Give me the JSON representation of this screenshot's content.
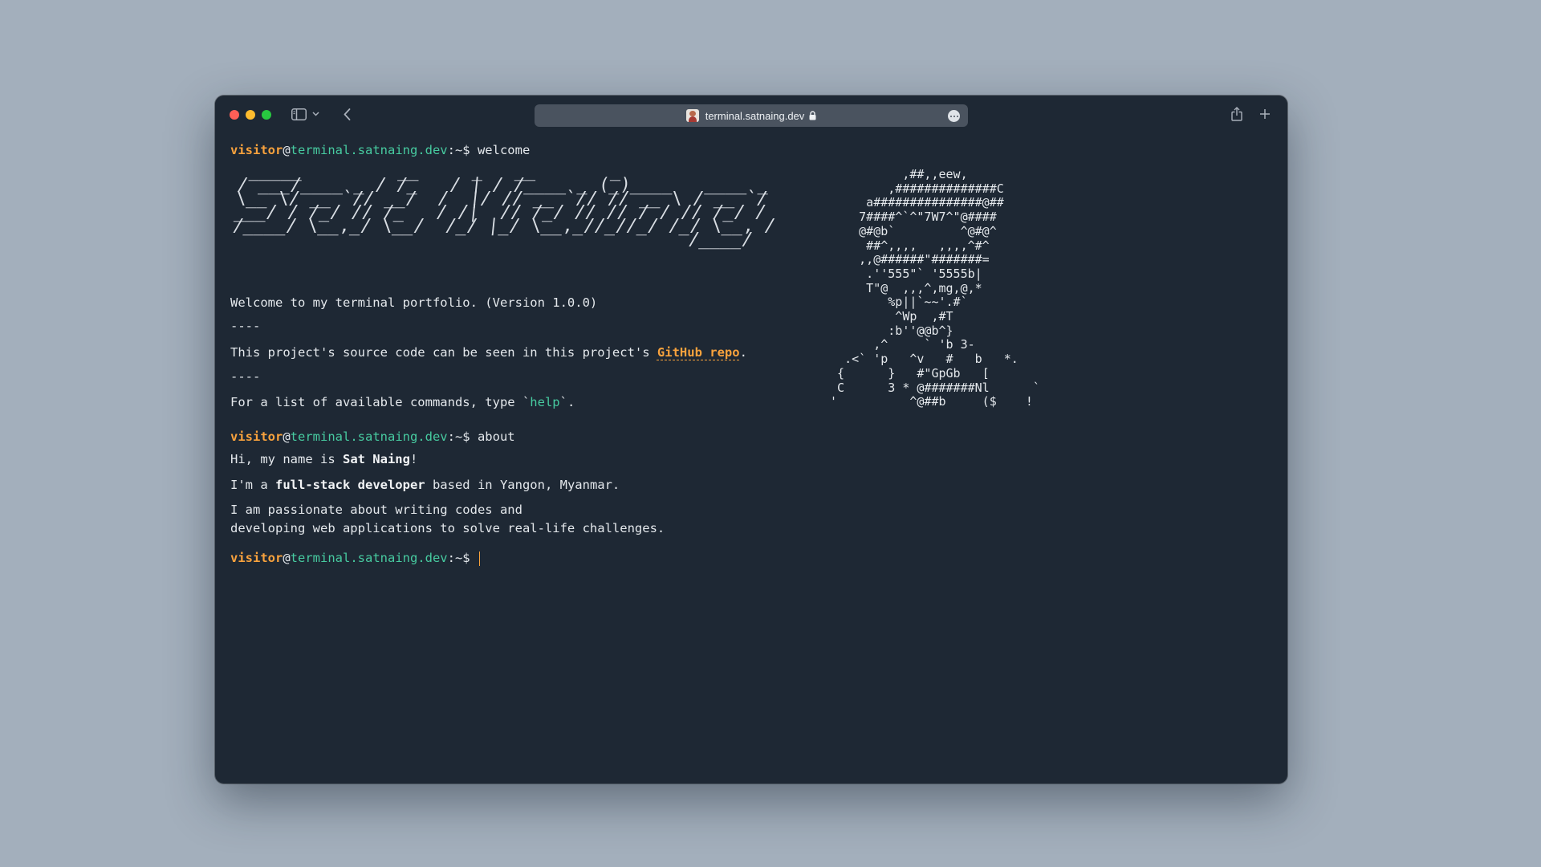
{
  "browser": {
    "url": "terminal.satnaing.dev"
  },
  "prompt": {
    "user": "visitor",
    "at": "@",
    "host": "terminal.satnaing.dev",
    "suffix": ":~$ "
  },
  "commands": {
    "first": "welcome",
    "second": "about"
  },
  "welcome": {
    "banner": " _____         __     _   __       _\n/ ___/____ _ / /_   / | / /____ _ (_)____   ____ _\n\\__ \\/ __ `// __/  /  |/ // __ `// // __ \\ / __ `/\n___/ / /_/ // /_   / /|  // /_/ // // / / // /_/ /\n/____/ \\__,_/ \\__/  /_/ |_/ \\__,_//_//_/ /_/ \\__, /\n                                           /____/",
    "intro": "Welcome to my terminal portfolio. (Version 1.0.0)",
    "separator": "----",
    "source_prefix": "This project's source code can be seen in this project's ",
    "source_link": "GitHub repo",
    "source_suffix": ".",
    "help_prefix": "For a list of available commands, type `",
    "help_cmd": "help",
    "help_suffix": "`.",
    "ascii_portrait": "           ,##,,eew,\n         ,##############C\n      a###############@##\n     7####^`^\"7W7^\"@####\n     @#@b`         ^@#@^\n      ##^,,,,   ,,,,^#^\n     ,,@######\"#######=\n      .''555\"` '5555b|\n      T\"@  ,,,^,mg,@,*\n         %p||`~~'.#`\n          ^Wp  ,#T\n         :b''@@b^}\n       ,^     ` 'b 3-\n   .<` 'p   ^v   #   b   *.\n  {      }   #\"GpGb   [\n  C      3 * @#######Nl      `\n '          ^@##b     ($    !"
  },
  "about": {
    "line1_prefix": "Hi, my name is ",
    "name": "Sat Naing",
    "line1_suffix": "!",
    "line2_prefix": "I'm a ",
    "role": "full-stack developer",
    "line2_suffix": " based in Yangon, Myanmar.",
    "line3": "I am passionate about writing codes and",
    "line4": "developing web applications to solve real-life challenges."
  }
}
